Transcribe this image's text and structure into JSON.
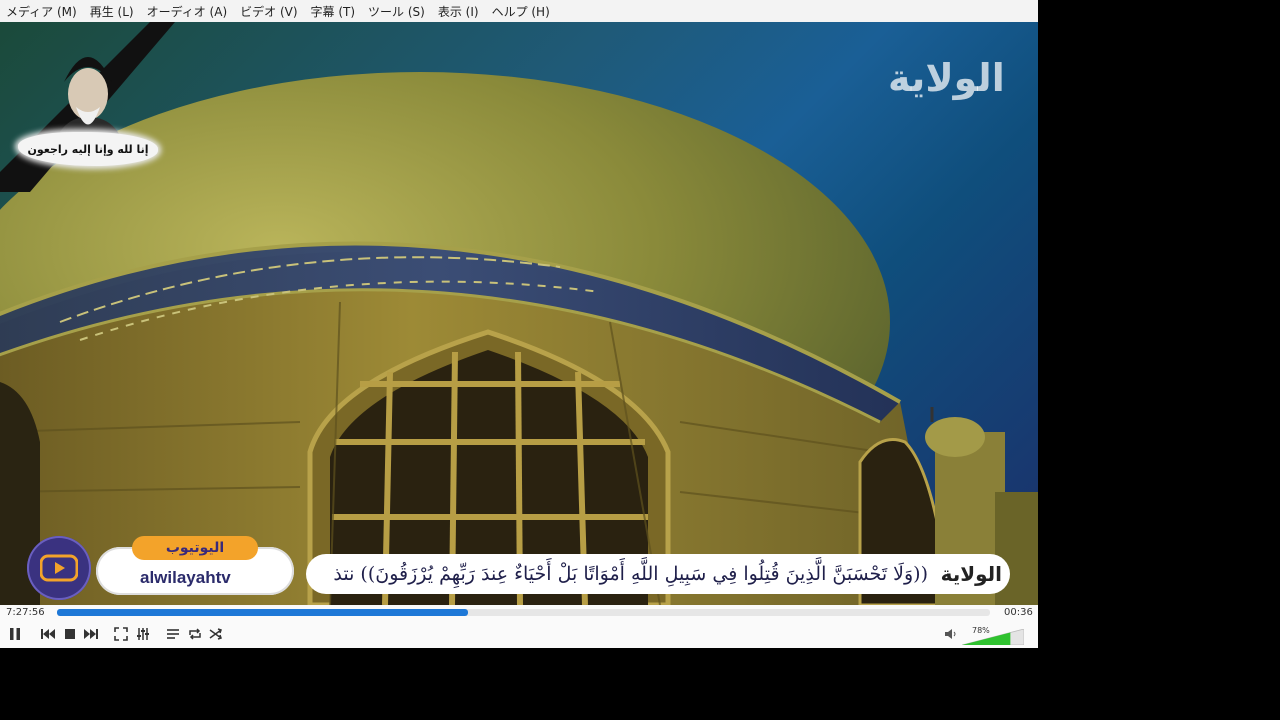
{
  "menu": [
    {
      "label": "メディア (M)"
    },
    {
      "label": "再生 (L)"
    },
    {
      "label": "オーディオ (A)"
    },
    {
      "label": "ビデオ (V)"
    },
    {
      "label": "字幕 (T)"
    },
    {
      "label": "ツール (S)"
    },
    {
      "label": "表示 (I)"
    },
    {
      "label": "ヘルプ (H)"
    }
  ],
  "video": {
    "channel_logo": "الولاية",
    "mourning_caption": "إنا لله وإنا إليه راجعون",
    "youtube_label": "اليوتيوب",
    "youtube_handle": "alwilayahtv",
    "ticker_text": "((وَلَا تَحْسَبَنَّ الَّذِينَ قُتِلُوا فِي سَبِيلِ اللَّهِ أَمْوَاتًا  بَلْ أَحْيَاءٌ عِندَ رَبِّهِمْ يُرْزَقُونَ)) نتذ",
    "ticker_logo": "الولاية"
  },
  "player": {
    "elapsed": "7:27:56",
    "total": "00:36",
    "progress_fraction": 0.44,
    "volume_label": "78%",
    "volume_fraction": 0.78,
    "controls": {
      "play_pause": "pause-icon",
      "previous": "previous-icon",
      "stop": "stop-icon",
      "next": "next-icon",
      "fullscreen": "fullscreen-icon",
      "extended": "equalizer-icon",
      "playlist": "playlist-icon",
      "loop": "loop-icon",
      "shuffle": "shuffle-icon",
      "mute": "speaker-icon"
    },
    "accent_color": "#1e78d7",
    "volume_color": "#2fc22f"
  }
}
